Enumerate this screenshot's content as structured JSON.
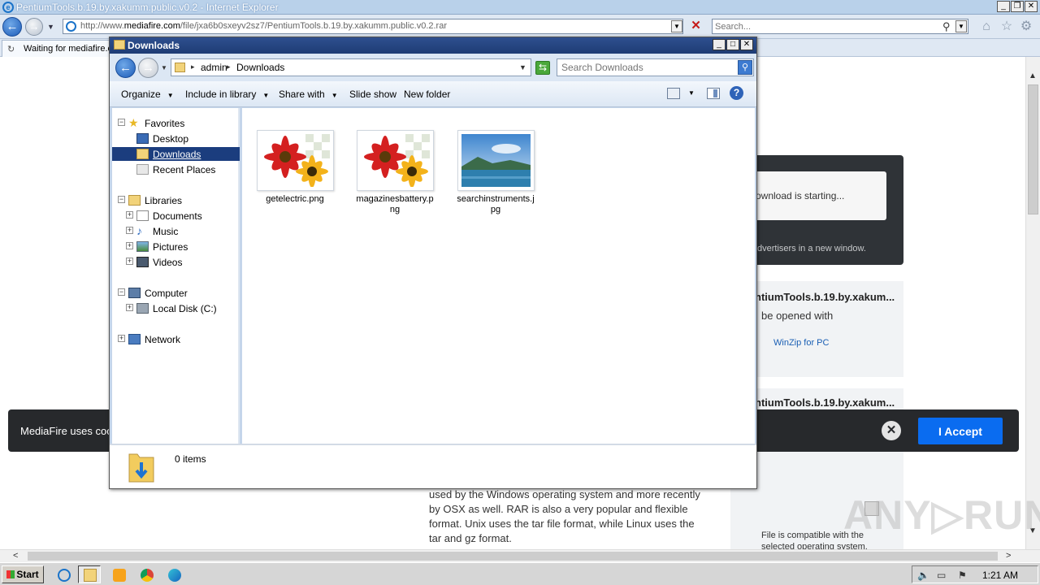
{
  "browser": {
    "window_title": "PentiumTools.b.19.by.xakumm.public.v0.2 - Internet Explorer",
    "url_prefix": "http://www.",
    "url_domain": "mediafire.com",
    "url_path": "/file/jxa6b0sxeyv2sz7/PentiumTools.b.19.by.xakumm.public.v0.2.rar",
    "search_placeholder": "Search...",
    "tab_label": "Waiting for mediafire.c"
  },
  "webpage": {
    "download_status": "ownload is starting...",
    "ad_text": "dvertisers in a new window.",
    "file_card_title": "ntiumTools.b.19.by.xakum...",
    "file_card_subtitle": "be opened with",
    "winzip_link": "WinZip for PC",
    "file_card2_title": "ntiumTools.b.19.by.xakum...",
    "compat_text": "File is compatible with the selected operating system.",
    "rar_paragraph": "used by the Windows operating system and more recently by OSX as well. RAR is also a very popular and flexible format. Unix uses the tar file format, while Linux uses the tar and gz format.",
    "cookie_text": "MediaFire uses coo",
    "accept_label": "I Accept",
    "close_glyph": "✕",
    "watermark": "ANY▷RUN"
  },
  "explorer": {
    "title": "Downloads",
    "breadcrumb": [
      "admin",
      "Downloads"
    ],
    "search_placeholder": "Search Downloads",
    "toolbar": {
      "organize": "Organize",
      "include_in_library": "Include in library",
      "share_with": "Share with",
      "slide_show": "Slide show",
      "new_folder": "New folder"
    },
    "nav": {
      "favorites": "Favorites",
      "desktop": "Desktop",
      "downloads": "Downloads",
      "recent_places": "Recent Places",
      "libraries": "Libraries",
      "documents": "Documents",
      "music": "Music",
      "pictures": "Pictures",
      "videos": "Videos",
      "computer": "Computer",
      "local_disk": "Local Disk (C:)",
      "network": "Network"
    },
    "files": [
      {
        "name": "getelectric.png",
        "icon": "flower-thumbnail-icon"
      },
      {
        "name": "magazinesbattery.png",
        "icon": "flower-thumbnail-icon"
      },
      {
        "name": "searchinstruments.jpg",
        "icon": "landscape-thumbnail-icon"
      }
    ],
    "details": "0 items"
  },
  "taskbar": {
    "start_label": "Start",
    "clock": "1:21 AM"
  }
}
